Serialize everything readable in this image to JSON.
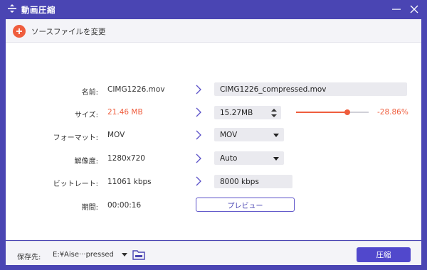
{
  "window": {
    "title": "動画圧縮"
  },
  "toolbar": {
    "add_source_label": "ソースファイルを変更"
  },
  "form": {
    "name": {
      "label": "名前:",
      "source": "CIMG1226.mov",
      "output": "CIMG1226_compressed.mov"
    },
    "size": {
      "label": "サイズ:",
      "source": "21.46 MB",
      "output": "15.27MB",
      "reduction": "-28.86%",
      "slider_level": 0.71
    },
    "format": {
      "label": "フォーマット:",
      "source": "MOV",
      "output": "MOV"
    },
    "resolution": {
      "label": "解像度:",
      "source": "1280x720",
      "output": "Auto"
    },
    "bitrate": {
      "label": "ビットレート:",
      "source": "11061 kbps",
      "output": "8000 kbps"
    },
    "duration": {
      "label": "期間:",
      "source": "00:00:16"
    },
    "preview_label": "プレビュー"
  },
  "footer": {
    "save_label": "保存先:",
    "save_path": "E:¥Aise···pressed",
    "compress_label": "圧縮"
  },
  "colors": {
    "brand": "#4a45b3",
    "accent": "#ef5d3d",
    "button": "#5148cc"
  },
  "icons": [
    "compress-icon",
    "minimize-icon",
    "close-icon",
    "plus-icon",
    "chevron-right-icon",
    "dropdown-arrow-icon",
    "spinner-icon",
    "folder-icon"
  ]
}
